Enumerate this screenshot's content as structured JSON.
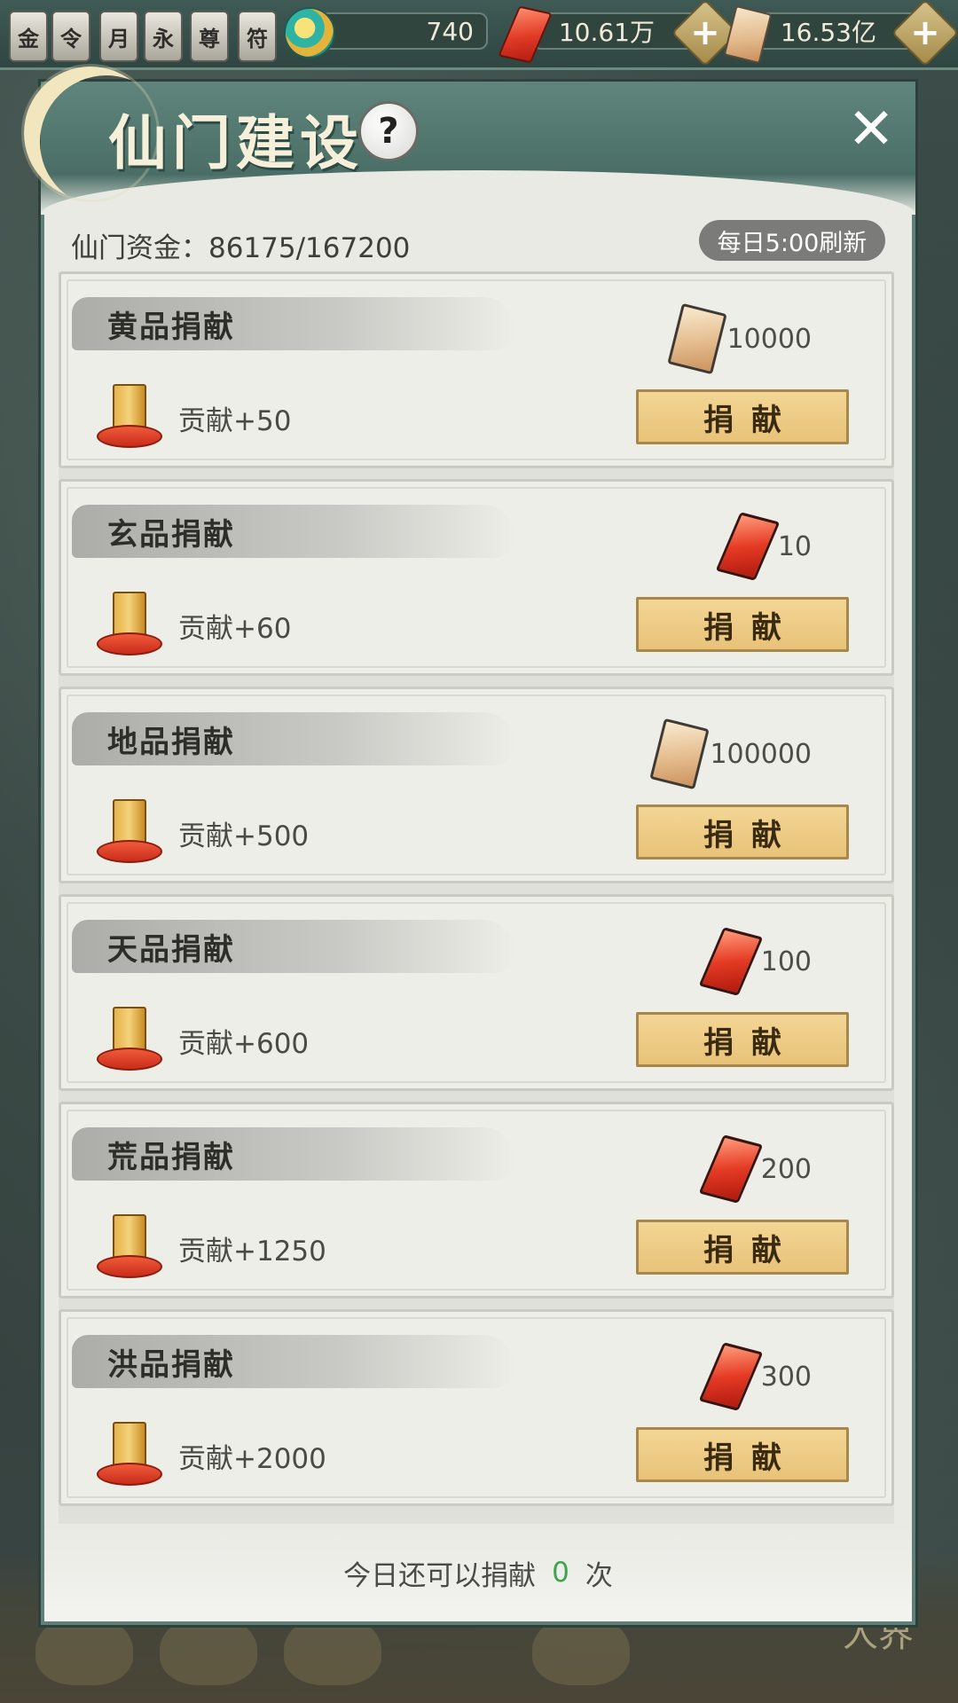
{
  "topbar": {
    "badges": [
      "金",
      "令",
      "月",
      "永",
      "尊",
      "符"
    ],
    "jade_value": "740",
    "gem_value": "10.61万",
    "ticket_value": "16.53亿",
    "plus": "+"
  },
  "panel": {
    "title": "仙门建设",
    "help": "?",
    "close": "✕",
    "funds_label": "仙门资金：",
    "funds_value": "86175/167200",
    "refresh_label": "每日5:00刷新"
  },
  "donations": [
    {
      "name": "黄品捐献",
      "cost_type": "ticket",
      "cost": "10000",
      "reward": "贡献+50",
      "button": "捐献"
    },
    {
      "name": "玄品捐献",
      "cost_type": "gem",
      "cost": "10",
      "reward": "贡献+60",
      "button": "捐献"
    },
    {
      "name": "地品捐献",
      "cost_type": "ticket",
      "cost": "100000",
      "reward": "贡献+500",
      "button": "捐献"
    },
    {
      "name": "天品捐献",
      "cost_type": "gem",
      "cost": "100",
      "reward": "贡献+600",
      "button": "捐献"
    },
    {
      "name": "荒品捐献",
      "cost_type": "gem",
      "cost": "200",
      "reward": "贡献+1250",
      "button": "捐献"
    },
    {
      "name": "洪品捐献",
      "cost_type": "gem",
      "cost": "300",
      "reward": "贡献+2000",
      "button": "捐献"
    }
  ],
  "footer": {
    "prefix": "今日还可以捐献",
    "remaining": "0",
    "suffix": "次"
  },
  "background": {
    "corner_label": "人界"
  },
  "colors": {
    "accent_green": "#3fa34d",
    "button_gold": "#e8c278",
    "panel_teal": "#4a6e66"
  }
}
